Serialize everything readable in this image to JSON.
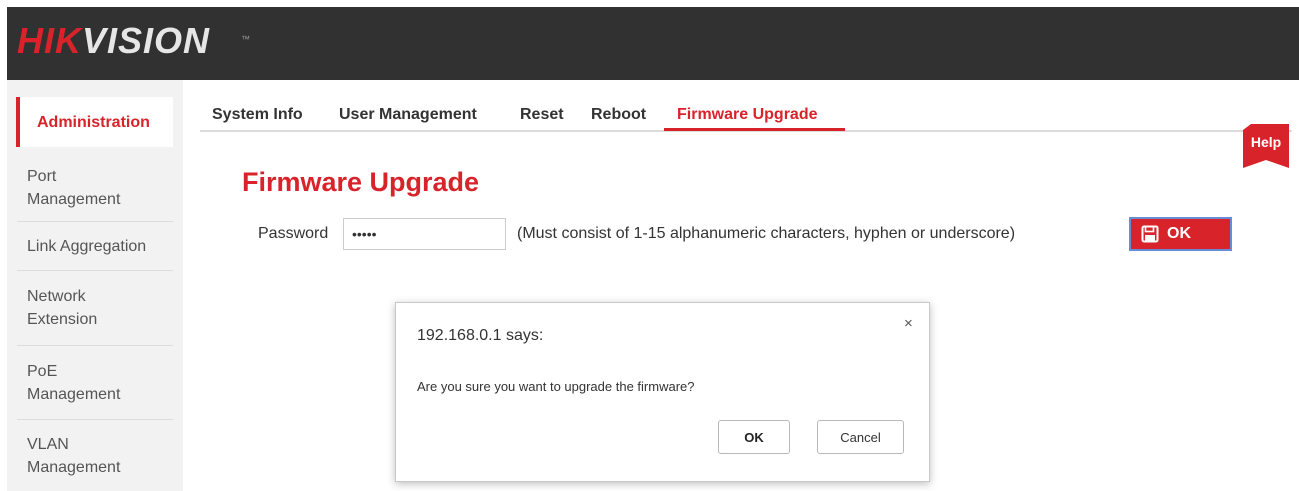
{
  "header": {
    "logo_hik": "HIK",
    "logo_vision": "VISION",
    "logo_tm": "™",
    "bg_color": "#313131",
    "brand_color": "#d9232a"
  },
  "sidebar": {
    "items": [
      {
        "label": "Administration",
        "active": true
      },
      {
        "label": "Port\nManagement",
        "active": false
      },
      {
        "label": "Link Aggregation",
        "active": false
      },
      {
        "label": "Network\nExtension",
        "active": false
      },
      {
        "label": "PoE\nManagement",
        "active": false
      },
      {
        "label": "VLAN\nManagement",
        "active": false
      }
    ]
  },
  "tabs": [
    {
      "label": "System Info"
    },
    {
      "label": "User Management"
    },
    {
      "label": "Reset"
    },
    {
      "label": "Reboot"
    },
    {
      "label": "Firmware Upgrade",
      "active": true
    }
  ],
  "help": {
    "label": "Help"
  },
  "main": {
    "title": "Firmware Upgrade",
    "password_label": "Password",
    "password_value": "•••••",
    "hint": "(Must consist of 1-15 alphanumeric characters, hyphen or underscore)",
    "ok_label": "OK",
    "ok_icon": "save-icon"
  },
  "dialog": {
    "title": "192.168.0.1 says:",
    "close_glyph": "×",
    "message": "Are you sure you want to upgrade the firmware?",
    "ok_label": "OK",
    "cancel_label": "Cancel"
  }
}
